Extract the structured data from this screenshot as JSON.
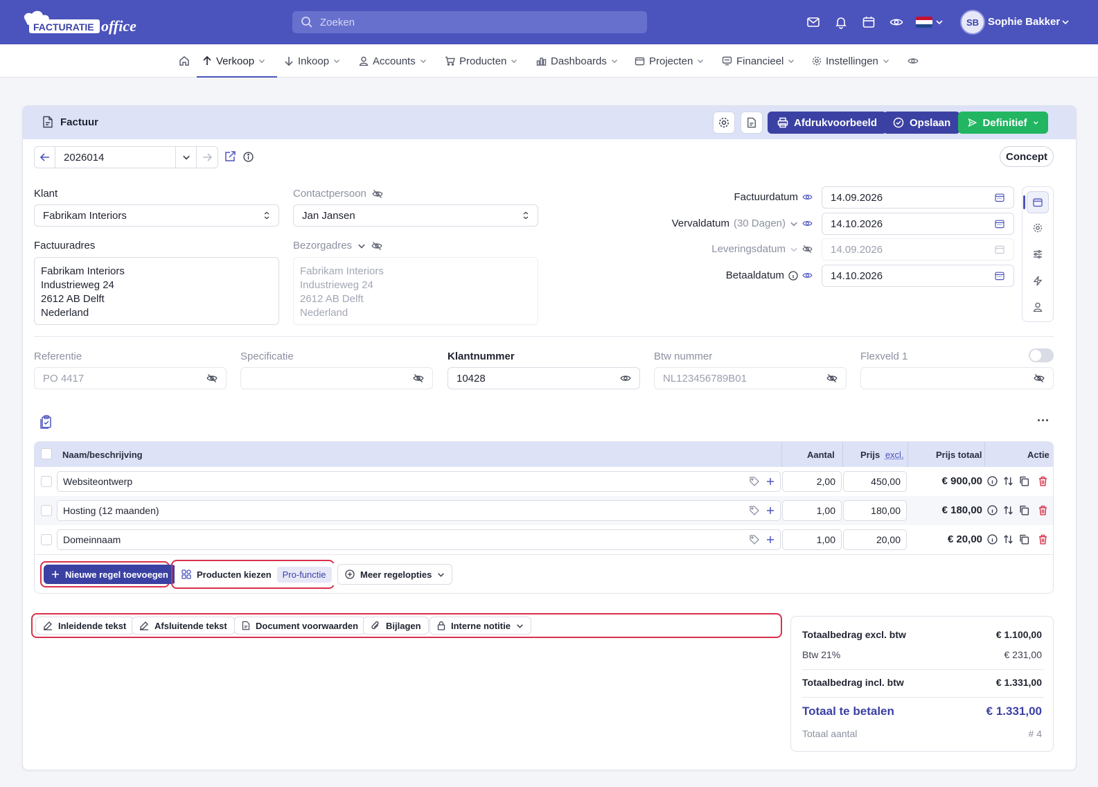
{
  "header": {
    "brand_word1": "FACTURATIE",
    "brand_word2": "office",
    "search_placeholder": "Zoeken",
    "user_initials": "SB",
    "user_name": "Sophie Bakker"
  },
  "nav": {
    "items": [
      "Verkoop",
      "Inkoop",
      "Accounts",
      "Producten",
      "Dashboards",
      "Projecten",
      "Financieel",
      "Instellingen"
    ],
    "active": "Verkoop"
  },
  "invoice": {
    "title": "Factuur",
    "print_label": "Afdrukvoorbeeld",
    "save_label": "Opslaan",
    "final_label": "Definitief",
    "number": "2026014",
    "status": "Concept"
  },
  "client": {
    "label": "Klant",
    "value": "Fabrikam Interiors",
    "contact_label": "Contactpersoon",
    "contact_value": "Jan Jansen",
    "address_label": "Factuuradres",
    "address": [
      "Fabrikam Interiors",
      "Industrieweg 24",
      "2612 AB Delft",
      "Nederland"
    ],
    "delivery_label": "Bezorgadres",
    "delivery_address": [
      "Fabrikam Interiors",
      "Industrieweg 24",
      "2612 AB Delft",
      "Nederland"
    ]
  },
  "dates": {
    "invoice_label": "Factuurdatum",
    "invoice_value": "14.09.2026",
    "due_label": "Vervaldatum",
    "due_hint": "(30 Dagen)",
    "due_value": "14.10.2026",
    "delivery_label": "Leveringsdatum",
    "delivery_value": "14.09.2026",
    "paid_label": "Betaaldatum",
    "paid_value": "14.10.2026"
  },
  "extra_fields": [
    {
      "label": "Referentie",
      "value": "PO 4417"
    },
    {
      "label": "Specificatie",
      "value": ""
    },
    {
      "label": "Klantnummer",
      "value": "10428"
    },
    {
      "label": "Btw nummer",
      "value": "NL123456789B01"
    },
    {
      "label": "Flexveld 1",
      "value": ""
    }
  ],
  "table": {
    "headers": {
      "name": "Naam/beschrijving",
      "qty": "Aantal",
      "price": "Prijs",
      "price_suffix": "excl.",
      "total": "Prijs totaal",
      "action": "Actie"
    },
    "rows": [
      {
        "name": "Websiteontwerp",
        "qty": "2,00",
        "price": "450,00",
        "total": "€ 900,00"
      },
      {
        "name": "Hosting (12 maanden)",
        "qty": "1,00",
        "price": "180,00",
        "total": "€ 180,00"
      },
      {
        "name": "Domeinnaam",
        "qty": "1,00",
        "price": "20,00",
        "total": "€ 20,00"
      }
    ]
  },
  "line_actions": {
    "add_line": "Nieuwe regel toevoegen",
    "choose_products": "Producten kiezen",
    "pro_badge": "Pro-functie",
    "more_options": "Meer regelopties"
  },
  "text_tabs": [
    "Inleidende tekst",
    "Afsluitende tekst",
    "Document voorwaarden",
    "Bijlagen",
    "Interne notitie"
  ],
  "totals": {
    "excl_label": "Totaalbedrag excl. btw",
    "excl_value": "€ 1.100,00",
    "vat_label": "Btw 21%",
    "vat_value": "€ 231,00",
    "incl_label": "Totaalbedrag incl. btw",
    "incl_value": "€ 1.331,00",
    "pay_label": "Totaal te betalen",
    "pay_value": "€ 1.331,00",
    "count_label": "Totaal aantal",
    "count_value": "# 4"
  },
  "colors": {
    "brand": "#4b53bc",
    "primary": "#3b41a3",
    "success": "#22b562",
    "highlight": "#d9304a"
  }
}
